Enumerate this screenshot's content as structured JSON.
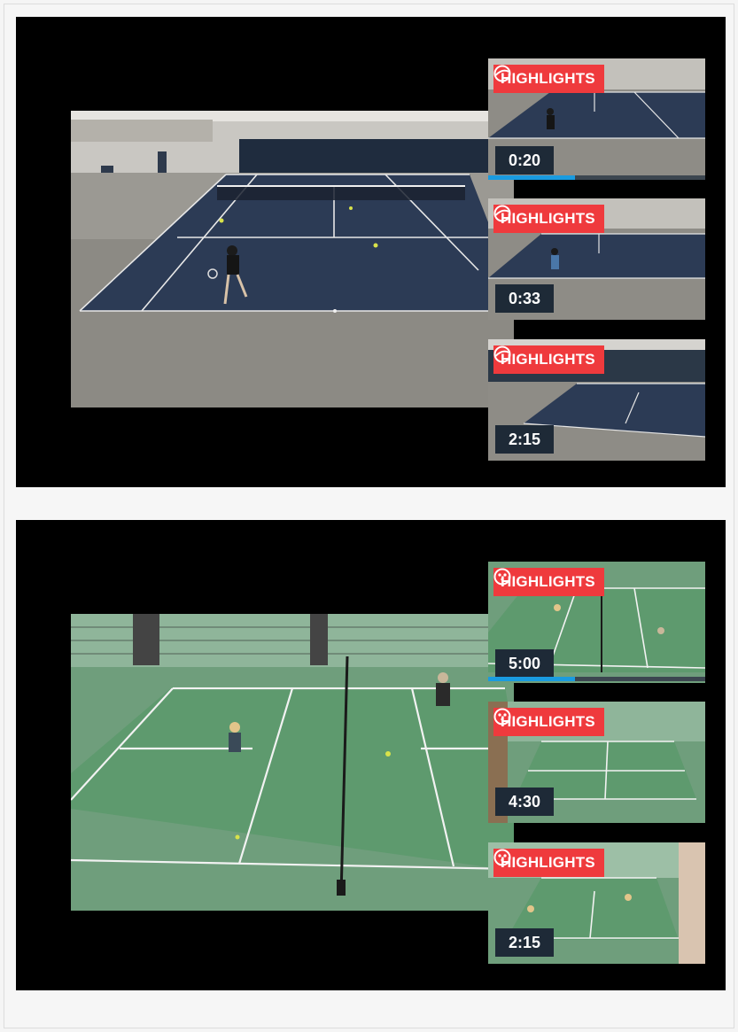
{
  "colors": {
    "highlight_red": "#ef3a3d",
    "time_badge_bg": "#1e2a37",
    "progress_blue": "#1a9be0",
    "tennis_court": "#2c3b55",
    "pickleball_court": "#5e9a6e"
  },
  "tennis_panel": {
    "sport_icon": "tennis-ball-icon",
    "thumbnails": [
      {
        "badge_label": "HIGHLIGHTS",
        "duration": "0:20",
        "progress": 0.4
      },
      {
        "badge_label": "HIGHLIGHTS",
        "duration": "0:33"
      },
      {
        "badge_label": "HIGHLIGHTS",
        "duration": "2:15"
      }
    ]
  },
  "pickleball_panel": {
    "sport_icon": "pickleball-icon",
    "thumbnails": [
      {
        "badge_label": "HIGHLIGHTS",
        "duration": "5:00",
        "progress": 0.4
      },
      {
        "badge_label": "HIGHLIGHTS",
        "duration": "4:30"
      },
      {
        "badge_label": "HIGHLIGHTS",
        "duration": "2:15"
      }
    ]
  }
}
